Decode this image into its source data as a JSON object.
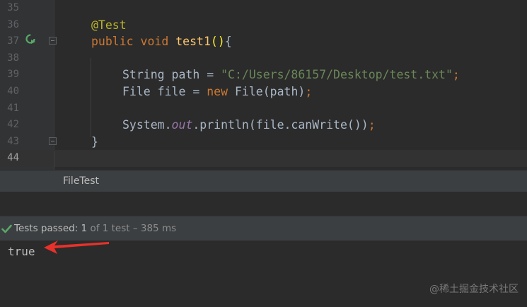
{
  "editor": {
    "lines": [
      {
        "n": "35"
      },
      {
        "n": "36"
      },
      {
        "n": "37"
      },
      {
        "n": "38"
      },
      {
        "n": "39"
      },
      {
        "n": "40"
      },
      {
        "n": "41"
      },
      {
        "n": "42"
      },
      {
        "n": "43"
      },
      {
        "n": "44"
      }
    ],
    "code": {
      "l36_annotation": "@Test",
      "l37_public": "public",
      "l37_void": "void",
      "l37_method": "test1",
      "l37_paren_open": "(",
      "l37_paren_close": ")",
      "l37_brace": "{",
      "l39_type": "String",
      "l39_assign": "path =",
      "l39_string": "\"C:/Users/86157/Desktop/test.txt\"",
      "l39_semicolon": ";",
      "l40_decl": "File file =",
      "l40_new": "new",
      "l40_ctor": "File(path)",
      "l40_semicolon": ";",
      "l42_system": "System.",
      "l42_out": "out",
      "l42_println": ".println(file.canWrite())",
      "l42_semicolon": ";",
      "l43_brace": "}"
    }
  },
  "tabs": {
    "filetest": "FileTest"
  },
  "status": {
    "passed_label": "Tests passed:",
    "passed_count": "1",
    "rest": "of 1 test – 385 ms"
  },
  "console": {
    "output": "true"
  },
  "watermark": "@稀土掘金技术社区",
  "colors": {
    "background": "#2b2b2b",
    "keyword": "#cc7832",
    "string": "#6a8759",
    "annotation": "#bbb529",
    "method": "#ffc66d",
    "pass_green": "#59a869",
    "arrow_red": "#e8312b"
  }
}
